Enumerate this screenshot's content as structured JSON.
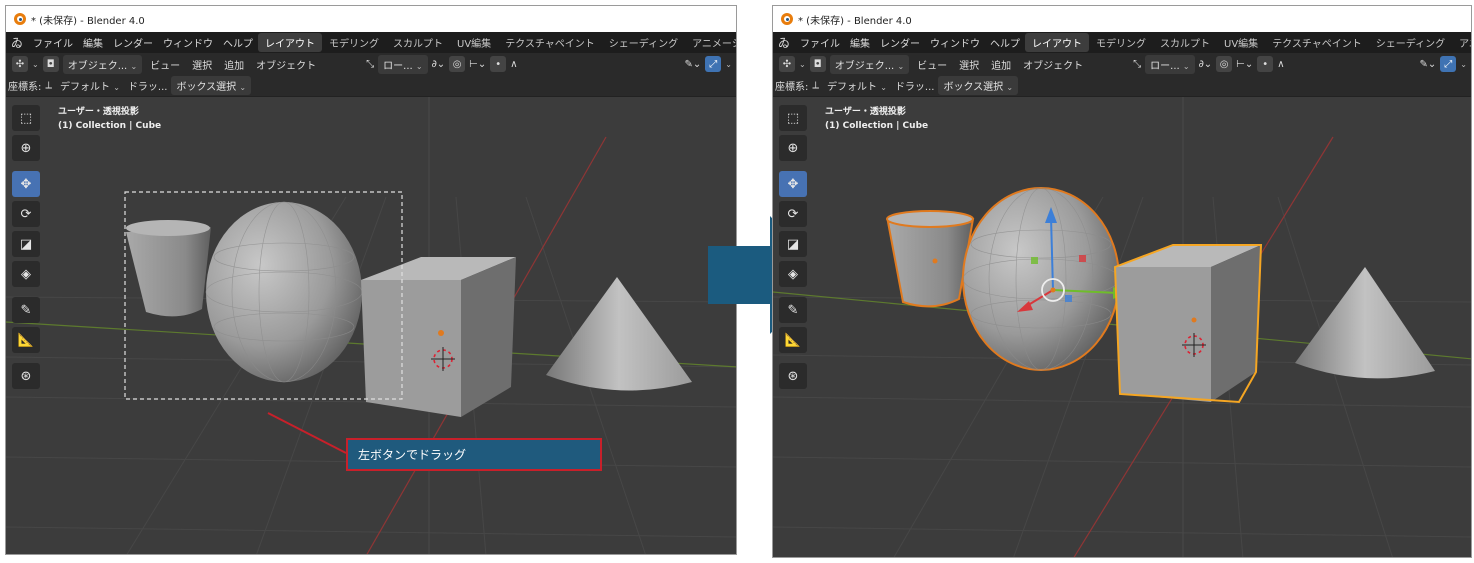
{
  "left": {
    "window_title": "* (未保存) - Blender 4.0",
    "menu": [
      "ファイル",
      "編集",
      "レンダー",
      "ウィンドウ",
      "ヘルプ"
    ],
    "workspaces": [
      {
        "label": "レイアウト",
        "active": true
      },
      {
        "label": "モデリング",
        "active": false
      },
      {
        "label": "スカルプト",
        "active": false
      },
      {
        "label": "UV編集",
        "active": false
      },
      {
        "label": "テクスチャペイント",
        "active": false
      },
      {
        "label": "シェーディング",
        "active": false
      },
      {
        "label": "アニメーシ",
        "active": false
      }
    ],
    "header": {
      "mode": "オブジェク...",
      "view": "ビュー",
      "select": "選択",
      "add": "追加",
      "object": "オブジェクト",
      "pivot": "ロー..."
    },
    "tool_settings": {
      "coord_label": "座標系:",
      "coord_value": "デフォルト",
      "drag_label": "ドラッ...",
      "drag_value": "ボックス選択"
    },
    "viewport_info": {
      "line1": "ユーザー・透視投影",
      "line2": "(1) Collection | Cube"
    },
    "tools": [
      "select-box",
      "cursor",
      "move",
      "rotate",
      "scale",
      "transform",
      "annotate",
      "measure",
      "add-cube"
    ],
    "callout": "左ボタンでドラッグ"
  },
  "right": {
    "window_title": "* (未保存) - Blender 4.0",
    "menu": [
      "ファイル",
      "編集",
      "レンダー",
      "ウィンドウ",
      "ヘルプ"
    ],
    "workspaces": [
      {
        "label": "レイアウト",
        "active": true
      },
      {
        "label": "モデリング",
        "active": false
      },
      {
        "label": "スカルプト",
        "active": false
      },
      {
        "label": "UV編集",
        "active": false
      },
      {
        "label": "テクスチャペイント",
        "active": false
      },
      {
        "label": "シェーディング",
        "active": false
      },
      {
        "label": "アニメーシ",
        "active": false
      }
    ],
    "header": {
      "mode": "オブジェク...",
      "view": "ビュー",
      "select": "選択",
      "add": "追加",
      "object": "オブジェクト",
      "pivot": "ロー..."
    },
    "tool_settings": {
      "coord_label": "座標系:",
      "coord_value": "デフォルト",
      "drag_label": "ドラッ...",
      "drag_value": "ボックス選択"
    },
    "viewport_info": {
      "line1": "ユーザー・透視投影",
      "line2": "(1) Collection | Cube"
    },
    "tools": [
      "select-box",
      "cursor",
      "move",
      "rotate",
      "scale",
      "transform",
      "annotate",
      "measure",
      "add-cube"
    ]
  },
  "colors": {
    "selection_outline": "#e07a1f",
    "active_outline": "#f5a623",
    "active_workspace": "#3d3d3d",
    "active_tool": "#4772b3",
    "arrow": "#1b5b7f",
    "callout_bg": "#1f5a7d",
    "callout_border": "#c8202a"
  }
}
